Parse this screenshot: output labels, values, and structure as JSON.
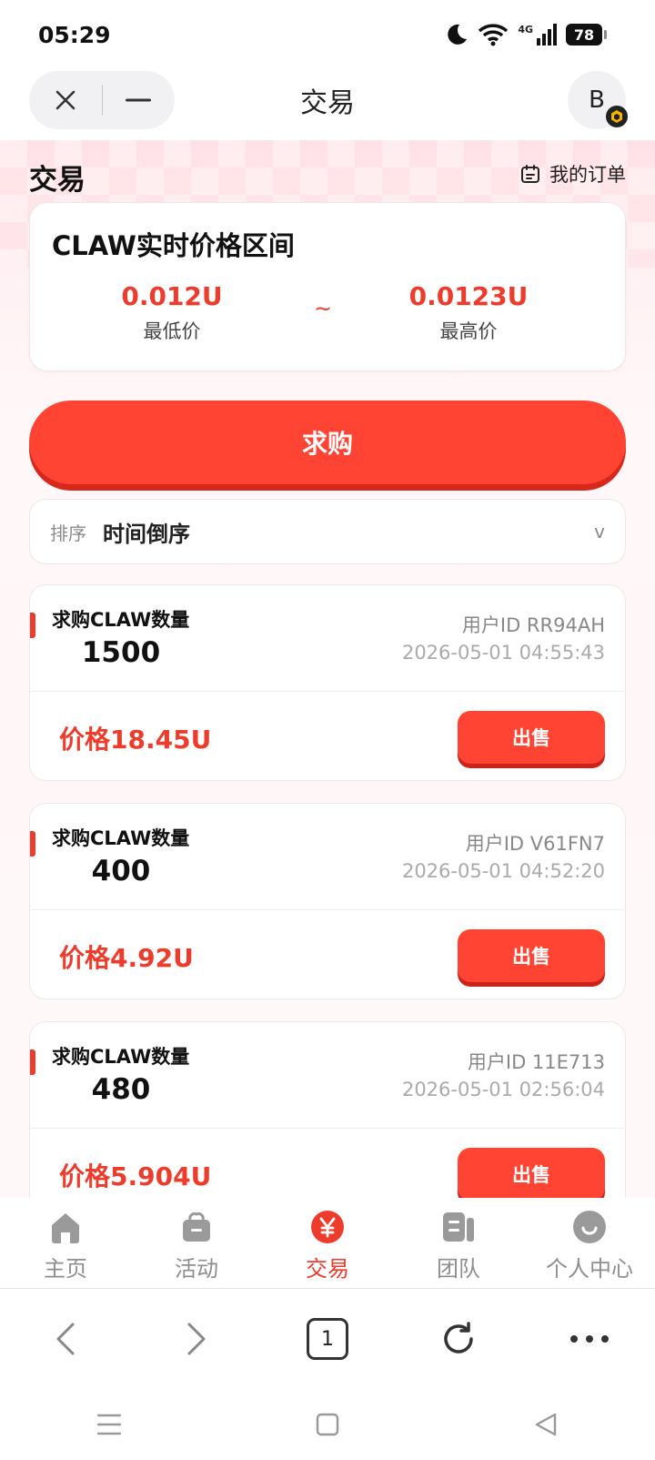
{
  "status_bar": {
    "time": "05:29",
    "network": "4G",
    "battery": "78"
  },
  "header": {
    "title": "交易",
    "avatar_letter": "B"
  },
  "page": {
    "title": "交易",
    "my_orders": "我的订单"
  },
  "price_range": {
    "title": "CLAW实时价格区间",
    "low_value": "0.012U",
    "low_label": "最低价",
    "separator": "~",
    "high_value": "0.0123U",
    "high_label": "最高价"
  },
  "buy_button": "求购",
  "sort": {
    "label": "排序",
    "value": "时间倒序",
    "chevron": "v"
  },
  "orders": [
    {
      "label": "求购CLAW数量",
      "quantity": "1500",
      "user_id": "用户ID RR94AH",
      "time": "2026-05-01 04:55:43",
      "price": "价格18.45U",
      "action": "出售"
    },
    {
      "label": "求购CLAW数量",
      "quantity": "400",
      "user_id": "用户ID V61FN7",
      "time": "2026-05-01 04:52:20",
      "price": "价格4.92U",
      "action": "出售"
    },
    {
      "label": "求购CLAW数量",
      "quantity": "480",
      "user_id": "用户ID 11E713",
      "time": "2026-05-01 02:56:04",
      "price": "价格5.904U",
      "action": "出售"
    }
  ],
  "tabs": [
    {
      "label": "主页",
      "icon": "home-icon"
    },
    {
      "label": "活动",
      "icon": "gift-icon"
    },
    {
      "label": "交易",
      "icon": "yuan-icon",
      "active": true
    },
    {
      "label": "团队",
      "icon": "team-icon"
    },
    {
      "label": "个人中心",
      "icon": "smile-icon"
    }
  ],
  "browser": {
    "tab_count": "1"
  },
  "colors": {
    "accent": "#ff4433",
    "price_red": "#ee3c2c",
    "tab_inactive": "#8e8e8e"
  }
}
